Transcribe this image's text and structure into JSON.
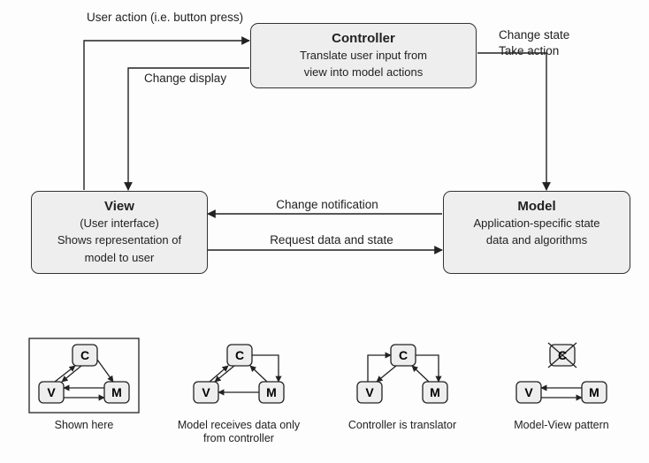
{
  "controller": {
    "title": "Controller",
    "sub": "Translate user input from",
    "sub2": "view into model actions"
  },
  "view": {
    "title": "View",
    "sub": "(User interface)",
    "sub2": "Shows representation of",
    "sub3": "model to user"
  },
  "model": {
    "title": "Model",
    "sub": "Application-specific state",
    "sub2": "data and algorithms"
  },
  "labels": {
    "user_action": "User action (i.e. button press)",
    "change_display": "Change display",
    "change_state": "Change state",
    "take_action": "Take action",
    "change_notification": "Change notification",
    "request_data": "Request data and state"
  },
  "mini": {
    "letters": {
      "c": "C",
      "v": "V",
      "m": "M"
    },
    "shown_here": "Shown here",
    "model_receives_l1": "Model receives data only",
    "model_receives_l2": "from controller",
    "translator": "Controller is translator",
    "mv_pattern": "Model-View pattern"
  },
  "chart_data": {
    "type": "diagram",
    "title": "Model-View-Controller architectural pattern",
    "nodes": [
      {
        "id": "controller",
        "label": "Controller",
        "description": "Translate user input from view into model actions"
      },
      {
        "id": "view",
        "label": "View",
        "description": "(User interface) Shows representation of model to user"
      },
      {
        "id": "model",
        "label": "Model",
        "description": "Application-specific state data and algorithms"
      }
    ],
    "edges": [
      {
        "from": "view",
        "to": "controller",
        "label": "User action (i.e. button press)"
      },
      {
        "from": "controller",
        "to": "view",
        "label": "Change display"
      },
      {
        "from": "controller",
        "to": "model",
        "label": "Change state / Take action"
      },
      {
        "from": "model",
        "to": "view",
        "label": "Change notification"
      },
      {
        "from": "view",
        "to": "model",
        "label": "Request data and state"
      }
    ],
    "variants": [
      {
        "caption": "Shown here",
        "edges": [
          {
            "from": "view",
            "to": "controller"
          },
          {
            "from": "controller",
            "to": "view"
          },
          {
            "from": "controller",
            "to": "model"
          },
          {
            "from": "model",
            "to": "view"
          },
          {
            "from": "view",
            "to": "model"
          }
        ]
      },
      {
        "caption": "Model receives data only from controller",
        "edges": [
          {
            "from": "view",
            "to": "controller"
          },
          {
            "from": "controller",
            "to": "view"
          },
          {
            "from": "controller",
            "to": "model"
          },
          {
            "from": "model",
            "to": "controller"
          },
          {
            "from": "model",
            "to": "view"
          }
        ]
      },
      {
        "caption": "Controller is translator",
        "edges": [
          {
            "from": "view",
            "to": "controller"
          },
          {
            "from": "controller",
            "to": "view"
          },
          {
            "from": "controller",
            "to": "model"
          },
          {
            "from": "model",
            "to": "controller"
          }
        ]
      },
      {
        "caption": "Model-View pattern",
        "controller_removed": true,
        "edges": [
          {
            "from": "model",
            "to": "view"
          },
          {
            "from": "view",
            "to": "model"
          }
        ]
      }
    ]
  }
}
